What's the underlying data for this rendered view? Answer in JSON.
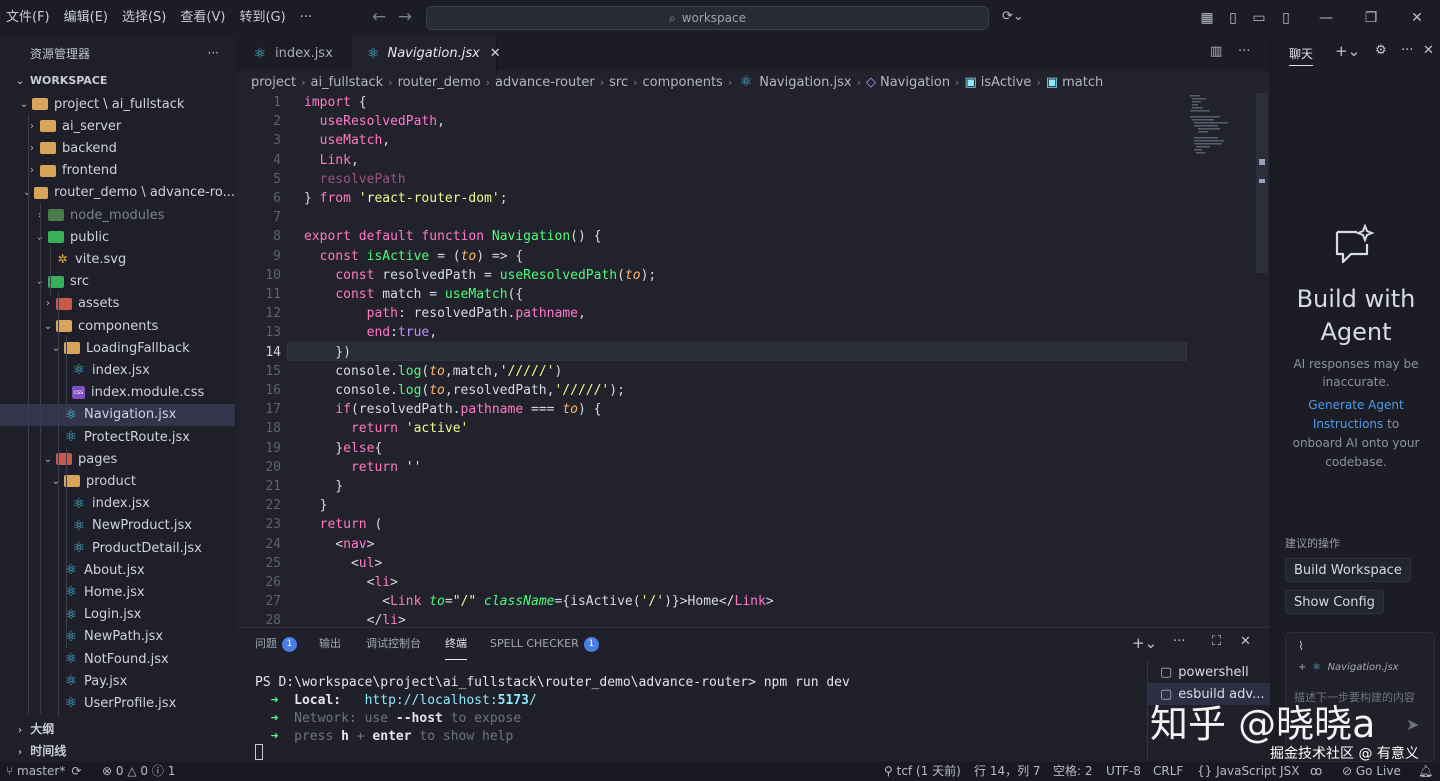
{
  "menu": [
    "文件(F)",
    "编辑(E)",
    "选择(S)",
    "查看(V)",
    "转到(G)",
    "···"
  ],
  "search": {
    "text": "workspace"
  },
  "sidebar": {
    "title": "资源管理器",
    "more": "···",
    "workspace_label": "WORKSPACE",
    "tree": [
      {
        "label": "project \\ ai_fullstack",
        "indent": 0,
        "kind": "folder-open"
      },
      {
        "label": "ai_server",
        "indent": 1,
        "kind": "folder-closed"
      },
      {
        "label": "backend",
        "indent": 1,
        "kind": "folder-closed"
      },
      {
        "label": "frontend",
        "indent": 1,
        "kind": "folder-closed"
      },
      {
        "label": "router_demo \\ advance-ro...",
        "indent": 1,
        "kind": "folder-open"
      },
      {
        "label": "node_modules",
        "indent": 2,
        "kind": "folder-closed-dim"
      },
      {
        "label": "public",
        "indent": 2,
        "kind": "folder-open-green"
      },
      {
        "label": "vite.svg",
        "indent": 3,
        "kind": "svg"
      },
      {
        "label": "src",
        "indent": 2,
        "kind": "folder-open-green"
      },
      {
        "label": "assets",
        "indent": 3,
        "kind": "folder-closed-red"
      },
      {
        "label": "components",
        "indent": 3,
        "kind": "folder-open"
      },
      {
        "label": "LoadingFallback",
        "indent": 4,
        "kind": "folder-open"
      },
      {
        "label": "index.jsx",
        "indent": 5,
        "kind": "react"
      },
      {
        "label": "index.module.css",
        "indent": 5,
        "kind": "css"
      },
      {
        "label": "Navigation.jsx",
        "indent": 4,
        "kind": "react",
        "selected": true
      },
      {
        "label": "ProtectRoute.jsx",
        "indent": 4,
        "kind": "react"
      },
      {
        "label": "pages",
        "indent": 3,
        "kind": "folder-open-red"
      },
      {
        "label": "product",
        "indent": 4,
        "kind": "folder-open"
      },
      {
        "label": "index.jsx",
        "indent": 5,
        "kind": "react"
      },
      {
        "label": "NewProduct.jsx",
        "indent": 5,
        "kind": "react"
      },
      {
        "label": "ProductDetail.jsx",
        "indent": 5,
        "kind": "react"
      },
      {
        "label": "About.jsx",
        "indent": 4,
        "kind": "react"
      },
      {
        "label": "Home.jsx",
        "indent": 4,
        "kind": "react"
      },
      {
        "label": "Login.jsx",
        "indent": 4,
        "kind": "react"
      },
      {
        "label": "NewPath.jsx",
        "indent": 4,
        "kind": "react"
      },
      {
        "label": "NotFound.jsx",
        "indent": 4,
        "kind": "react"
      },
      {
        "label": "Pay.jsx",
        "indent": 4,
        "kind": "react"
      },
      {
        "label": "UserProfile.jsx",
        "indent": 4,
        "kind": "react"
      }
    ],
    "outline": "大纲",
    "timeline": "时间线"
  },
  "tabs": [
    {
      "label": "index.jsx",
      "active": false
    },
    {
      "label": "Navigation.jsx",
      "active": true
    }
  ],
  "breadcrumb": [
    "project",
    "ai_fullstack",
    "router_demo",
    "advance-router",
    "src",
    "components",
    "Navigation.jsx",
    "Navigation",
    "isActive",
    "match"
  ],
  "editor": {
    "current_line": 14,
    "lines": [
      "import {",
      "  useResolvedPath,",
      "  useMatch,",
      "  Link,",
      "  resolvePath",
      "} from 'react-router-dom';",
      "",
      "export default function Navigation() {",
      "  const isActive = (to) => {",
      "    const resolvedPath = useResolvedPath(to);",
      "    const match = useMatch({",
      "        path: resolvedPath.pathname,",
      "        end:true,",
      "    })",
      "    console.log(to,match,'/////')",
      "    console.log(to,resolvedPath,'/////');",
      "    if(resolvedPath.pathname === to) {",
      "      return 'active'",
      "    }else{",
      "      return ''",
      "    }",
      "  }",
      "  return (",
      "    <nav>",
      "      <ul>",
      "        <li>",
      "          <Link to=\"/\" className={isActive('/')}>Home</Link>",
      "        </li>"
    ]
  },
  "panel": {
    "tabs": [
      {
        "label": "问题",
        "badge": "1"
      },
      {
        "label": "输出"
      },
      {
        "label": "调试控制台"
      },
      {
        "label": "终端",
        "active": true
      },
      {
        "label": "SPELL CHECKER",
        "badge": "1"
      }
    ],
    "terminal": {
      "prompt": "PS D:\\workspace\\project\\ai_fullstack\\router_demo\\advance-router> ",
      "command": "npm run dev",
      "local_label": "Local:",
      "local_url_prefix": "http://localhost:",
      "local_port": "5173",
      "local_url_suffix": "/",
      "network_label": "Network:",
      "network_pre": "use",
      "network_flag": "--host",
      "network_post": "to expose",
      "help_pre": "press",
      "help_key1": "h",
      "help_plus": "+",
      "help_key2": "enter",
      "help_post": "to show help",
      "arrow": "➜"
    },
    "terminals": [
      "powershell",
      "esbuild  adv..."
    ]
  },
  "chat": {
    "tab": "聊天",
    "title": "Build with Agent",
    "disclaimer": "AI responses may be inaccurate.",
    "link_text": "Generate Agent Instructions",
    "link_tail": "to onboard AI onto your codebase.",
    "suggest_label": "建议的操作",
    "buttons": [
      "Build Workspace",
      "Show Config"
    ],
    "context_file": "Navigation.jsx",
    "input_placeholder": "描述下一步要构建的内容"
  },
  "statusbar": {
    "branch": "master*",
    "errors": "0",
    "warnings": "0",
    "info": "1",
    "git_user": "tcf (1 天前)",
    "position": "行 14，列 7",
    "spaces": "空格: 2",
    "encoding": "UTF-8",
    "eol": "CRLF",
    "language": "JavaScript JSX",
    "golive": "Go Live"
  },
  "watermark": {
    "main": "知乎 @晓晓a",
    "sub": "掘金技术社区 @ 有意义"
  }
}
